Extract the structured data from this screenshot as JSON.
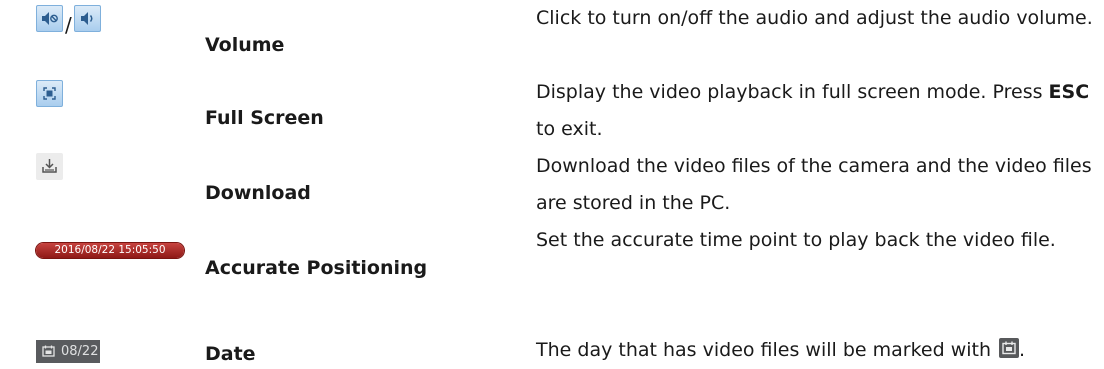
{
  "rows": [
    {
      "icons": [
        "volume-mute-icon",
        "volume-on-icon"
      ],
      "separator": "/",
      "name": "Volume",
      "desc": "Click to turn on/off the audio and adjust the audio volume."
    },
    {
      "icons": [
        "fullscreen-icon"
      ],
      "name": "Full Screen",
      "desc_pre": "Display the video playback in full screen mode. Press ",
      "desc_bold": "ESC",
      "desc_post": " to exit."
    },
    {
      "icons": [
        "download-icon"
      ],
      "name": "Download",
      "desc": "Download the video files of the camera and the video files are stored in the PC."
    },
    {
      "widget_text": "2016/08/22 15:05:50",
      "name": "Accurate Positioning",
      "desc": "Set the accurate time point to play back the video file."
    },
    {
      "icons": [
        "video-file-icon"
      ],
      "widget_text": "08/22",
      "name": "Date",
      "desc_pre": "The day that has video files will be marked with",
      "desc_icon": "video-file-icon",
      "desc_post": "."
    }
  ],
  "colors": {
    "button_blue": "#a9cdee",
    "positioning_red": "#b3302c",
    "date_box": "#595b5e"
  }
}
